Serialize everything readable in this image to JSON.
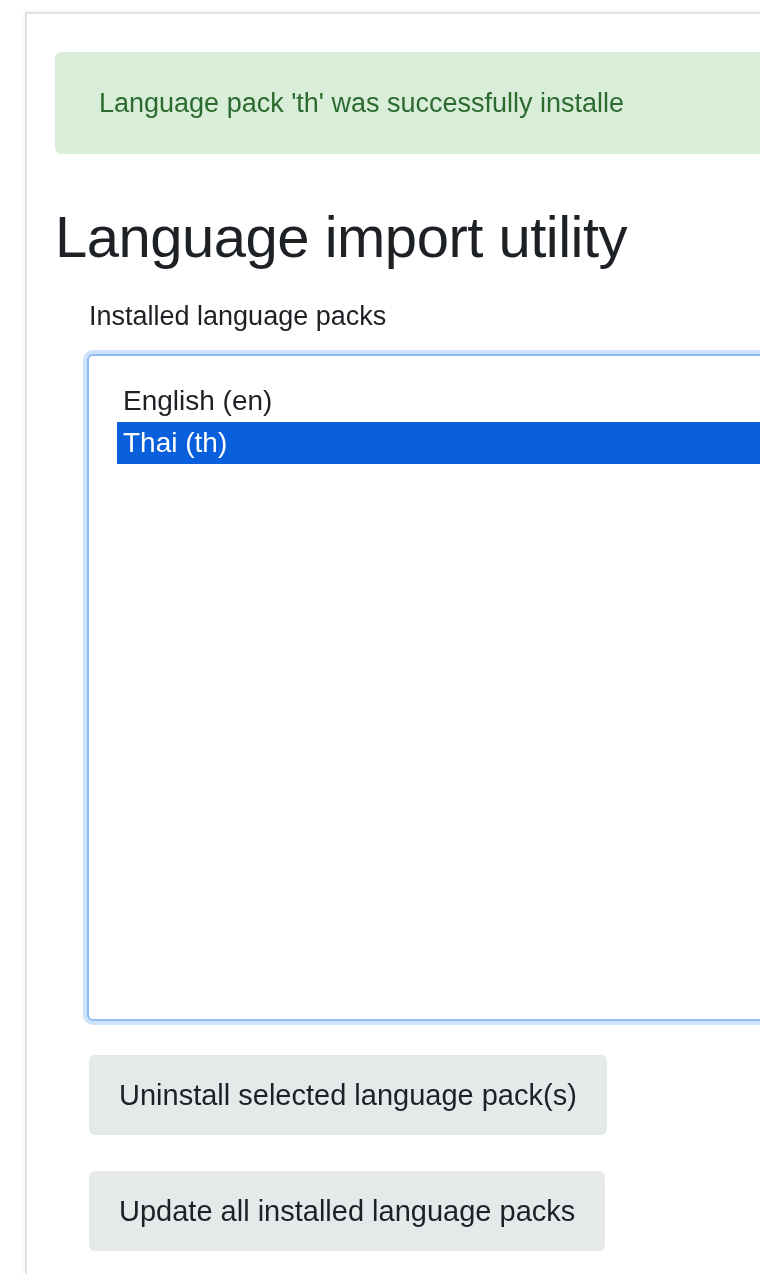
{
  "alert": {
    "text": "Language pack 'th' was successfully installe"
  },
  "heading": "Language import utility",
  "installed": {
    "label": "Installed language packs",
    "options": [
      {
        "label": "English (en)",
        "selected": false
      },
      {
        "label": "Thai (th)",
        "selected": true
      }
    ]
  },
  "buttons": [
    "Uninstall selected language pack(s)",
    "Update all installed language packs"
  ]
}
